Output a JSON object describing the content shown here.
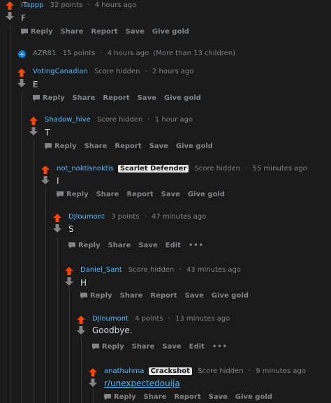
{
  "actions": {
    "reply": "Reply",
    "share": "Share",
    "report": "Report",
    "save": "Save",
    "give_gold": "Give gold",
    "edit": "Edit",
    "more": "•••"
  },
  "sep": "·",
  "comments": [
    {
      "user": "iTappp",
      "score": "32 points",
      "time": "4 hours ago",
      "body": "F"
    },
    {
      "user": "AZR81",
      "score": "15 points",
      "time": "4 hours ago",
      "children": "(More than 13 children)"
    },
    {
      "user": "VotingCanadian",
      "score": "Score hidden",
      "time": "2 hours ago",
      "body": "E"
    },
    {
      "user": "Shadow_hive",
      "score": "Score hidden",
      "time": "1 hour ago",
      "body": "T"
    },
    {
      "user": "not_noktisnoktis",
      "flair": "Scarlet Defender",
      "score": "Score hidden",
      "time": "55 minutes ago",
      "body": "I"
    },
    {
      "user": "DJloumont",
      "score": "3 points",
      "time": "47 minutes ago",
      "body": "S"
    },
    {
      "user": "Daniel_Sant",
      "score": "Score hidden",
      "time": "43 minutes ago",
      "body": "H"
    },
    {
      "user": "DJloumont",
      "score": "4 points",
      "time": "13 minutes ago",
      "body": "Goodbye."
    },
    {
      "user": "anathuhma",
      "flair": "Crackshot",
      "score": "Score hidden",
      "time": "9 minutes ago",
      "body": "r/unexpectedouija"
    }
  ],
  "colors": {
    "upvote": "#ff4500",
    "downvote": "#818384",
    "username": "#4fbcff",
    "muted": "#818384",
    "thread_line": "#343536",
    "background": "#1a1a1b"
  }
}
